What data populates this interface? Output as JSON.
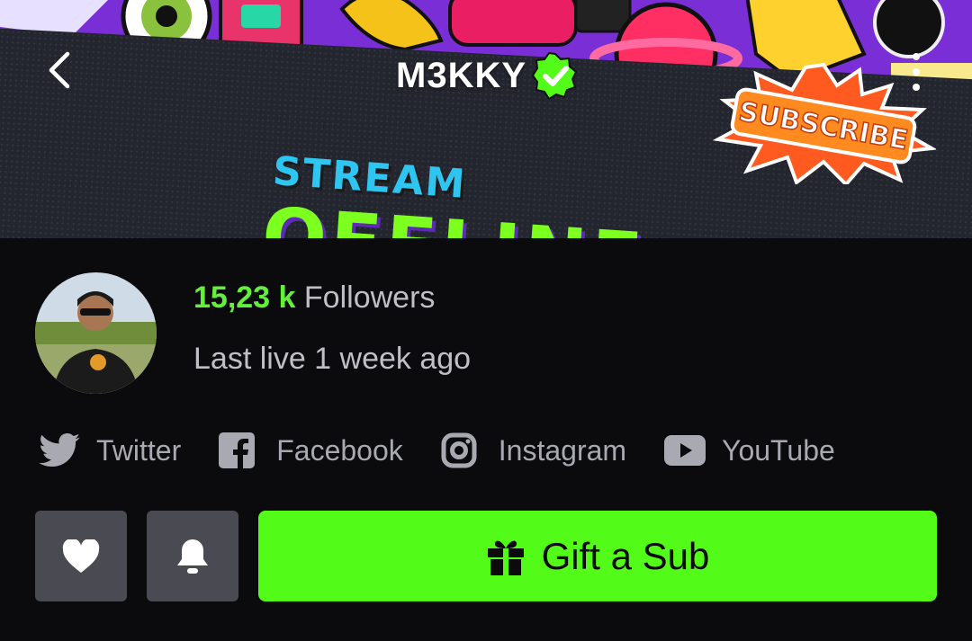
{
  "header": {
    "channel_name": "M3KKY",
    "verified": true,
    "back_icon": "chevron-left-icon",
    "more_icon": "more-vertical-icon"
  },
  "banner": {
    "stream_text": "STREAM",
    "offline_text": "OFFLINE",
    "subscribe_text": "SUBSCRIBE"
  },
  "profile": {
    "followers_count": "15,23 k",
    "followers_label": "Followers",
    "last_live": "Last live 1 week ago"
  },
  "social_links": [
    {
      "label": "Twitter",
      "icon": "twitter-icon"
    },
    {
      "label": "Facebook",
      "icon": "facebook-icon"
    },
    {
      "label": "Instagram",
      "icon": "instagram-icon"
    },
    {
      "label": "YouTube",
      "icon": "youtube-icon"
    }
  ],
  "actions": {
    "follow_icon": "heart-icon",
    "notify_icon": "bell-icon",
    "gift_label": "Gift a Sub",
    "gift_icon": "gift-icon"
  },
  "colors": {
    "accent": "#53fc18",
    "background": "#0b0b0d",
    "button_gray": "#4a4b52",
    "text_muted": "#bfbfc6"
  }
}
